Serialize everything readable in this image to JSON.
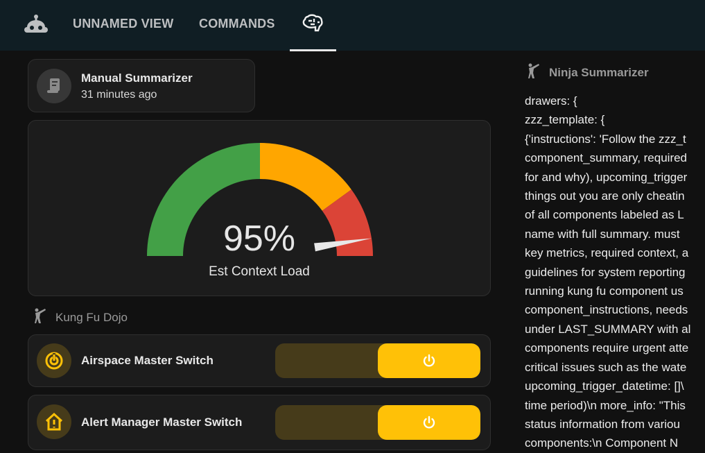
{
  "nav": {
    "tabs": [
      {
        "label": "UNNAMED VIEW"
      },
      {
        "label": "COMMANDS"
      },
      {
        "icon": "brain-icon",
        "active": true
      }
    ]
  },
  "summarizer_card": {
    "title": "Manual Summarizer",
    "subtitle": "31 minutes ago",
    "icon": "script-icon"
  },
  "gauge": {
    "value": 95,
    "value_text": "95%",
    "label": "Est Context Load",
    "segments": [
      {
        "from": 0,
        "to": 50,
        "color": "#43a047"
      },
      {
        "from": 50,
        "to": 80,
        "color": "#ffa600"
      },
      {
        "from": 80,
        "to": 100,
        "color": "#db4437"
      }
    ]
  },
  "dojo": {
    "title": "Kung Fu Dojo",
    "switches": [
      {
        "name": "Airspace Master Switch",
        "icon": "radar-icon",
        "state": "on"
      },
      {
        "name": "Alert Manager Master Switch",
        "icon": "home-alert-icon",
        "state": "on"
      }
    ]
  },
  "ninja": {
    "title": "Ninja Summarizer",
    "lines": [
      "drawers: {",
      "zzz_template: {",
      "{'instructions': 'Follow the zzz_t",
      "component_summary, required",
      "for and why), upcoming_trigger",
      "things out you are only cheatin",
      "of all components labeled as L",
      "name with full summary. must",
      "key metrics, required context, a",
      "guidelines for system reporting",
      "running kung fu component us",
      "component_instructions, needs",
      "under LAST_SUMMARY with al",
      "components require urgent atte",
      "critical issues such as the wate",
      "upcoming_trigger_datetime: []\\",
      "time period)\\n more_info: \"This",
      "status information from variou",
      "components:\\n Component N"
    ]
  },
  "colors": {
    "accent": "#ffc107",
    "topbar": "#101e24"
  }
}
